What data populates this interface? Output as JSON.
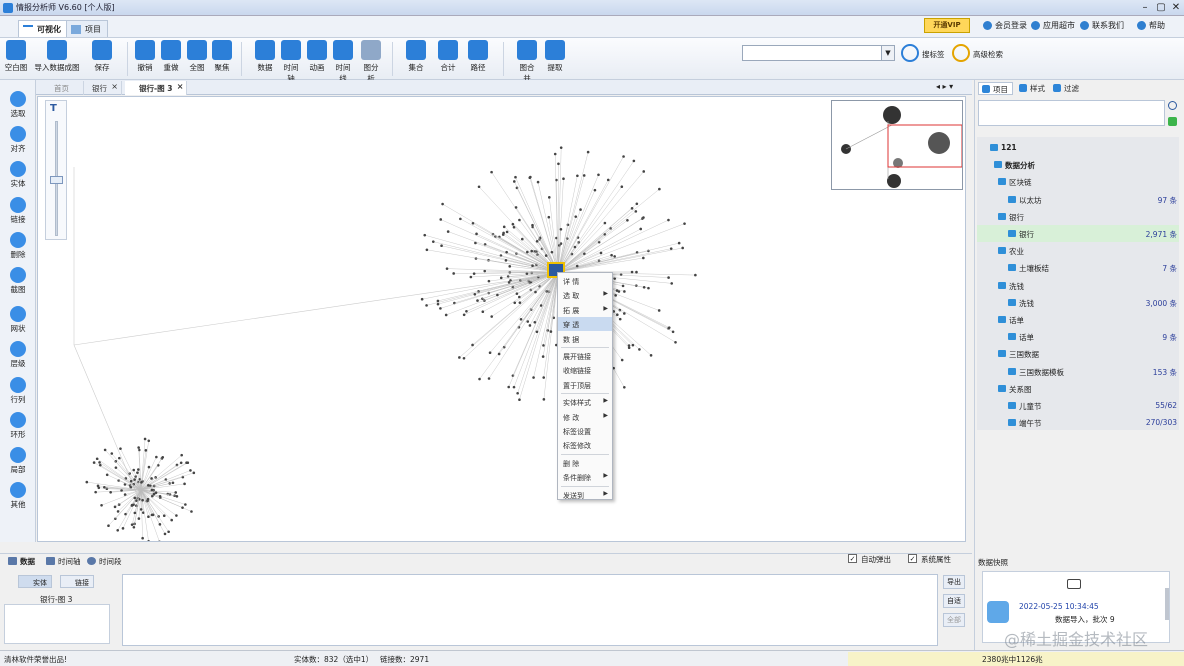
{
  "window": {
    "title": "情报分析师 V6.60 [个人版]",
    "min": "–",
    "max": "▢",
    "close": "✕"
  },
  "ribbon_tabs": [
    {
      "label": "可视化"
    },
    {
      "label": "项目"
    }
  ],
  "top_links": {
    "vip": "开通VIP",
    "login": "会员登录",
    "appstore": "应用超市",
    "contact": "联系我们",
    "help": "帮助"
  },
  "toolbar": [
    {
      "label": "空白图",
      "color": "#2c7fd8"
    },
    {
      "label": "导入数据成图",
      "color": "#2c7fd8"
    },
    {
      "label": "保存",
      "color": "#2c7fd8"
    },
    {
      "label": "撤销",
      "color": "#2c7fd8"
    },
    {
      "label": "重做",
      "color": "#2c7fd8"
    },
    {
      "label": "全图",
      "color": "#2c7fd8"
    },
    {
      "label": "聚焦",
      "color": "#2c7fd8"
    },
    {
      "label": "数据",
      "color": "#2c7fd8"
    },
    {
      "label": "时间轴",
      "color": "#2c7fd8"
    },
    {
      "label": "动画",
      "color": "#2c7fd8"
    },
    {
      "label": "时间线",
      "color": "#2c7fd8"
    },
    {
      "label": "图分析",
      "color": "#8fa8c8"
    },
    {
      "label": "集合",
      "color": "#2c7fd8"
    },
    {
      "label": "合计",
      "color": "#2c7fd8"
    },
    {
      "label": "路径",
      "color": "#2c7fd8"
    },
    {
      "label": "图合并",
      "color": "#2c7fd8"
    },
    {
      "label": "提取",
      "color": "#2c7fd8"
    }
  ],
  "search": {
    "value": "",
    "tag_search": "搜标签",
    "advanced_search": "高级检索"
  },
  "left_tools": [
    {
      "label": "选取"
    },
    {
      "label": "对齐"
    },
    {
      "label": "实体"
    },
    {
      "label": "链接"
    },
    {
      "label": "删除"
    },
    {
      "label": "截图"
    },
    {
      "label": "网状"
    },
    {
      "label": "层级"
    },
    {
      "label": "行列"
    },
    {
      "label": "环形"
    },
    {
      "label": "局部"
    },
    {
      "label": "其他"
    }
  ],
  "doc_tabs": [
    {
      "label": "首页"
    },
    {
      "label": "银行"
    },
    {
      "label": "银行-图 3"
    }
  ],
  "zoom_label": "T",
  "context_menu": [
    {
      "label": "详 情",
      "sub": false
    },
    {
      "label": "选 取",
      "sub": true
    },
    {
      "label": "拓 展",
      "sub": true
    },
    {
      "label": "穿 透",
      "sub": false
    },
    {
      "label": "数 据",
      "sub": false
    },
    {
      "label": "展开链接",
      "sub": false
    },
    {
      "label": "收缩链接",
      "sub": false
    },
    {
      "label": "置于顶层",
      "sub": false
    },
    {
      "label": "实体样式",
      "sub": true
    },
    {
      "label": "修 改",
      "sub": true
    },
    {
      "label": "标签设置",
      "sub": false
    },
    {
      "label": "标签修改",
      "sub": false
    },
    {
      "label": "删 除",
      "sub": false
    },
    {
      "label": "条件删除",
      "sub": true
    },
    {
      "label": "发送到",
      "sub": true
    }
  ],
  "panel_tabs": [
    {
      "label": "项目"
    },
    {
      "label": "样式"
    },
    {
      "label": "过滤"
    }
  ],
  "tree": {
    "root": "121",
    "project": "数据分析",
    "groups": [
      {
        "name": "区块链",
        "items": [
          {
            "name": "以太坊",
            "count": "97 条"
          }
        ]
      },
      {
        "name": "银行",
        "items": [
          {
            "name": "银行",
            "count": "2,971 条"
          }
        ]
      },
      {
        "name": "农业",
        "items": [
          {
            "name": "土壤板结",
            "count": "7 条"
          }
        ]
      },
      {
        "name": "洗钱",
        "items": [
          {
            "name": "洗钱",
            "count": "3,000 条"
          }
        ]
      },
      {
        "name": "话单",
        "items": [
          {
            "name": "话单",
            "count": "9 条"
          }
        ]
      },
      {
        "name": "三国数据",
        "items": [
          {
            "name": "三国数据模板",
            "count": "153 条"
          }
        ]
      },
      {
        "name": "关系图",
        "items": [
          {
            "name": "儿童节",
            "count": "55/62"
          },
          {
            "name": "端午节",
            "count": "270/303"
          }
        ]
      }
    ]
  },
  "quick_photo": {
    "header": "数据快照",
    "date": "2022-05-25 10:34:45",
    "desc": "数据导入，批次 9"
  },
  "bottom": {
    "tabs": [
      {
        "label": "数据"
      },
      {
        "label": "时间轴"
      },
      {
        "label": "时间段"
      }
    ],
    "auto_popup": "自动弹出",
    "sys_attr": "系统属性",
    "entity_btn": "实体",
    "link_btn": "链接",
    "graph_name": "银行-图 3",
    "export": "导出",
    "adapt": "自适",
    "all": "全部"
  },
  "status": {
    "left": "清林软件荣誉出品!",
    "entities": "实体数：832（选中1）",
    "links": "链接数：2971",
    "right": "2380兆中1126兆"
  },
  "watermark": "@稀土掘金技术社区",
  "colors": {
    "accent": "#2c7fd8",
    "selected_row": "#d8f0d8",
    "menu_highlight": "#c9daf0",
    "vip": "#ffd75a"
  }
}
